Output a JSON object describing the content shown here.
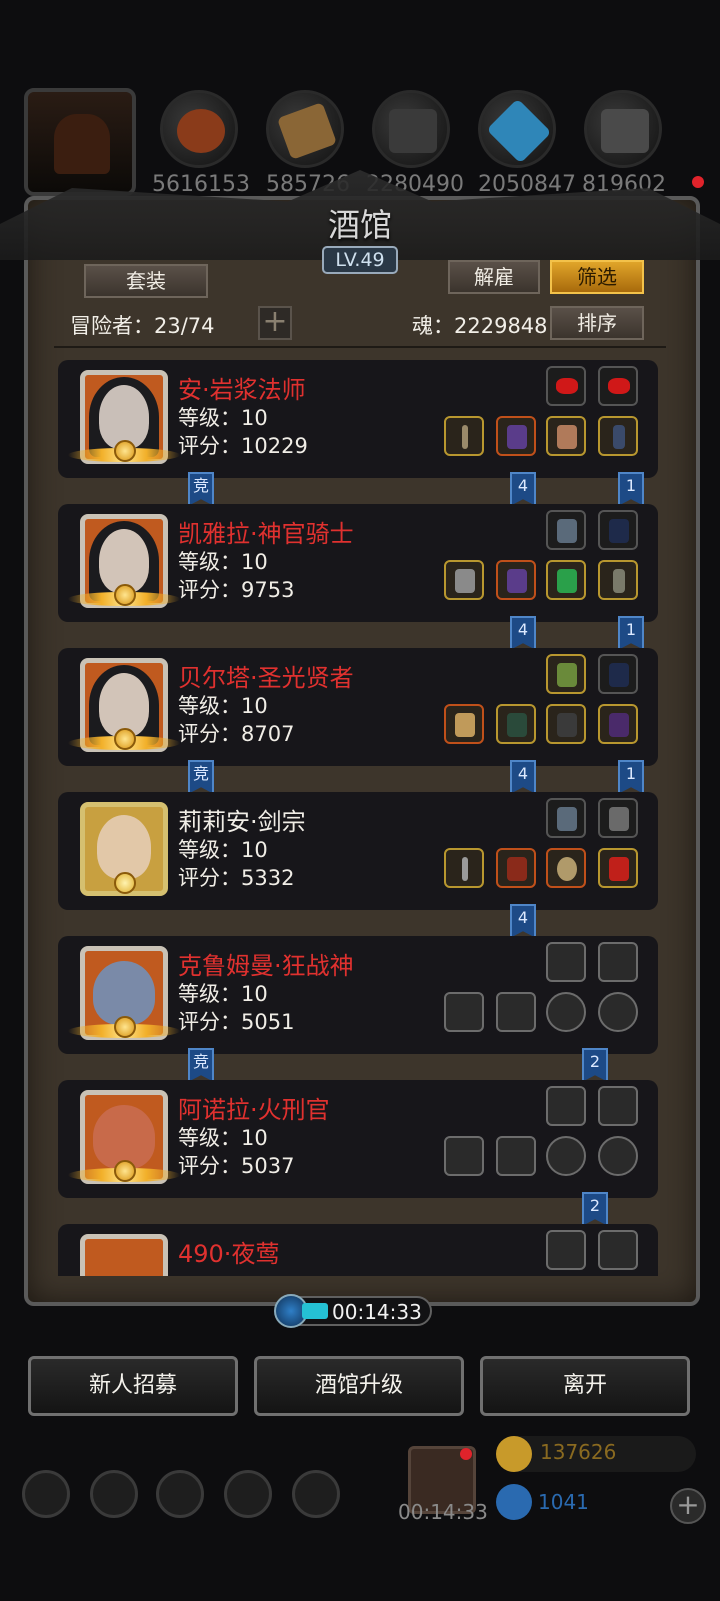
{
  "resources": [
    {
      "icon": "torch-icon",
      "count": ""
    },
    {
      "icon": "meat-icon",
      "count": "5616153"
    },
    {
      "icon": "wood-icon",
      "count": "585726"
    },
    {
      "icon": "stone-icon",
      "count": "2280490"
    },
    {
      "icon": "crystal-icon",
      "count": "2050847"
    },
    {
      "icon": "iron-icon",
      "count": "819602"
    }
  ],
  "tavern": {
    "title": "酒馆",
    "level": "LV.49",
    "outfit_label": "套装",
    "dismiss_label": "解雇",
    "filter_label": "筛选",
    "sort_label": "排序",
    "adventurers_label": "冒险者：23/74",
    "soul_label": "魂：2229848",
    "plus_label": "+"
  },
  "heroes": [
    {
      "name": "安·岩浆法师",
      "level": "等级：10",
      "score": "评分：10229",
      "name_color": "red",
      "tag_left": "竞",
      "tag_mid": "4",
      "tag_right": "1"
    },
    {
      "name": "凯雅拉·神官骑士",
      "level": "等级：10",
      "score": "评分：9753",
      "name_color": "red",
      "tag_left": "",
      "tag_mid": "4",
      "tag_right": "1"
    },
    {
      "name": "贝尔塔·圣光贤者",
      "level": "等级：10",
      "score": "评分：8707",
      "name_color": "red",
      "tag_left": "竞",
      "tag_mid": "4",
      "tag_right": "1"
    },
    {
      "name": "莉莉安·剑宗",
      "level": "等级：10",
      "score": "评分：5332",
      "name_color": "white",
      "tag_left": "",
      "tag_mid": "4",
      "tag_right": ""
    },
    {
      "name": "克鲁姆曼·狂战神",
      "level": "等级：10",
      "score": "评分：5051",
      "name_color": "red",
      "tag_left": "竞",
      "tag_mid": "",
      "tag_right": "2"
    },
    {
      "name": "阿诺拉·火刑官",
      "level": "等级：10",
      "score": "评分：5037",
      "name_color": "red",
      "tag_left": "",
      "tag_mid": "",
      "tag_right": "2"
    },
    {
      "name": "490·夜莺",
      "level": "",
      "score": "",
      "name_color": "red",
      "tag_left": "",
      "tag_mid": "",
      "tag_right": ""
    }
  ],
  "timer": "00:14:33",
  "actions": {
    "recruit_label": "新人招募",
    "upgrade_label": "酒馆升级",
    "leave_label": "离开"
  },
  "footer": {
    "gift_timer": "00:14:33",
    "gold": "137626",
    "gems": "1041"
  },
  "colors": {
    "hero_red": "#e0312f",
    "gold_button": "#e0a52a",
    "tag_blue": "#1d4a86"
  }
}
